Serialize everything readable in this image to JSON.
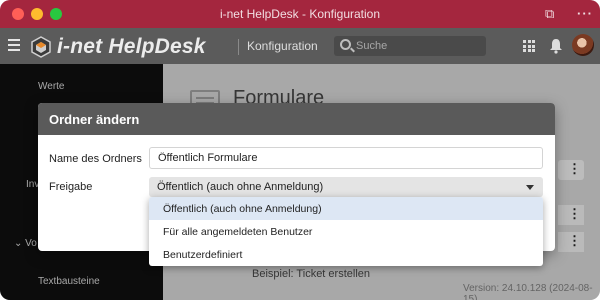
{
  "window": {
    "title": "i-net HelpDesk - Konfiguration"
  },
  "header": {
    "app_name": "i-net HelpDesk",
    "section": "Konfiguration",
    "search_placeholder": "Suche"
  },
  "background": {
    "sidebar_items": [
      "Werte",
      "Inv",
      "Vo",
      "Textbausteine"
    ],
    "page_title": "Formulare",
    "row_snippet": "Beispiel: Ticket erstellen",
    "version": "Version: 24.10.128 (2024-08-15)"
  },
  "modal": {
    "title": "Ordner ändern",
    "name_label": "Name des Ordners",
    "name_value": "Öffentlich Formulare",
    "share_label": "Freigabe",
    "share_value": "Öffentlich (auch ohne Anmeldung)",
    "share_options": [
      "Öffentlich (auch ohne Anmeldung)",
      "Für alle angemeldeten Benutzer",
      "Benutzerdefiniert"
    ]
  },
  "colors": {
    "titlebar": "#a4263e",
    "appbar": "#5b5b5b",
    "modal_header": "#5a5a5a",
    "option_highlight": "#dde7f4"
  },
  "icons": {
    "menu": "hamburger-icon",
    "logo": "helpdesk-logo-icon",
    "search": "search-icon",
    "apps": "apps-grid-icon",
    "notifications": "bell-icon",
    "more": "more-horizontal-icon",
    "picture_in_picture": "pip-icon"
  }
}
